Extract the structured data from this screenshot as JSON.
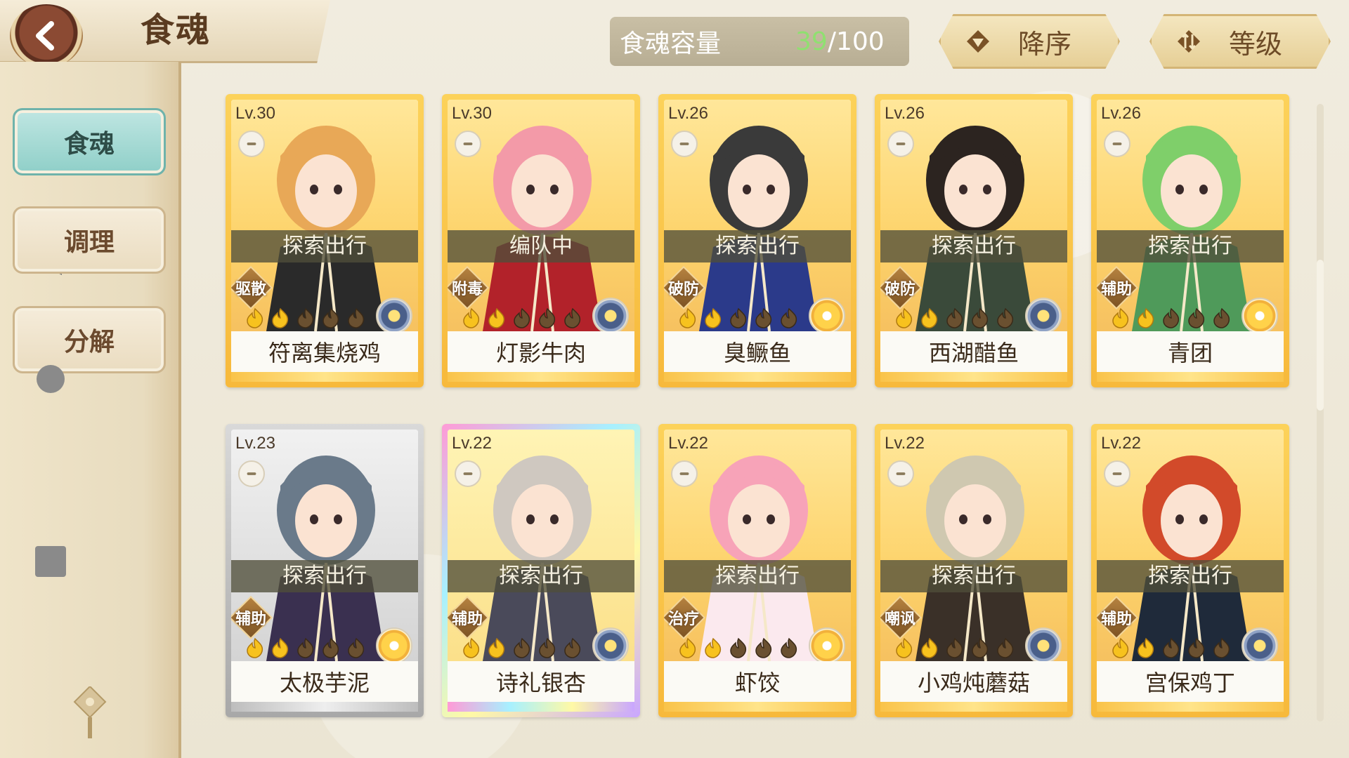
{
  "header": {
    "title": "食魂"
  },
  "sidebar": {
    "items": [
      {
        "label": "食魂",
        "active": true
      },
      {
        "label": "调理",
        "active": false
      },
      {
        "label": "分解",
        "active": false
      }
    ]
  },
  "capacity": {
    "label": "食魂容量",
    "current": "39",
    "separator": "/",
    "max": "100"
  },
  "sort": {
    "order_label": "降序",
    "field_label": "等级"
  },
  "colors": {
    "accent_teal": "#8fcfc8",
    "capacity_green": "#8fe070",
    "card_gold": "#f7b93b",
    "header_brown": "#5a3b20"
  },
  "cards": [
    {
      "level": "Lv.30",
      "status": "探索出行",
      "role": "驱散",
      "name": "符离集烧鸡",
      "rarity": "gold",
      "stars": 2,
      "element": "blue",
      "hair": "#e8a857",
      "outfit": "#2a2a2a"
    },
    {
      "level": "Lv.30",
      "status": "编队中",
      "role": "附毒",
      "name": "灯影牛肉",
      "rarity": "gold",
      "stars": 2,
      "element": "blue",
      "hair": "#f39aa8",
      "outfit": "#b2222a"
    },
    {
      "level": "Lv.26",
      "status": "探索出行",
      "role": "破防",
      "name": "臭鳜鱼",
      "rarity": "gold",
      "stars": 2,
      "element": "gold",
      "hair": "#3a3a3a",
      "outfit": "#2b3a8a"
    },
    {
      "level": "Lv.26",
      "status": "探索出行",
      "role": "破防",
      "name": "西湖醋鱼",
      "rarity": "gold",
      "stars": 2,
      "element": "blue",
      "hair": "#2c2420",
      "outfit": "#3a4a3a"
    },
    {
      "level": "Lv.26",
      "status": "探索出行",
      "role": "辅助",
      "name": "青团",
      "rarity": "gold",
      "stars": 2,
      "element": "gold",
      "hair": "#7fcf6a",
      "outfit": "#4f9a5a"
    },
    {
      "level": "Lv.23",
      "status": "探索出行",
      "role": "辅助",
      "name": "太极芋泥",
      "rarity": "silver",
      "stars": 2,
      "element": "gold",
      "hair": "#6a7a8a",
      "outfit": "#3a3050"
    },
    {
      "level": "Lv.22",
      "status": "探索出行",
      "role": "辅助",
      "name": "诗礼银杏",
      "rarity": "rainbow",
      "stars": 2,
      "element": "blue",
      "hair": "#cfc8c0",
      "outfit": "#4a4a5a"
    },
    {
      "level": "Lv.22",
      "status": "探索出行",
      "role": "治疗",
      "name": "虾饺",
      "rarity": "gold",
      "stars": 2,
      "element": "gold",
      "hair": "#f7a3b8",
      "outfit": "#fbe9ee"
    },
    {
      "level": "Lv.22",
      "status": "探索出行",
      "role": "嘲讽",
      "name": "小鸡炖蘑菇",
      "rarity": "gold",
      "stars": 2,
      "element": "blue",
      "hair": "#cfc8b0",
      "outfit": "#3a3028"
    },
    {
      "level": "Lv.22",
      "status": "探索出行",
      "role": "辅助",
      "name": "宫保鸡丁",
      "rarity": "gold",
      "stars": 2,
      "element": "blue",
      "hair": "#d24a2a",
      "outfit": "#1f2a3a"
    }
  ]
}
